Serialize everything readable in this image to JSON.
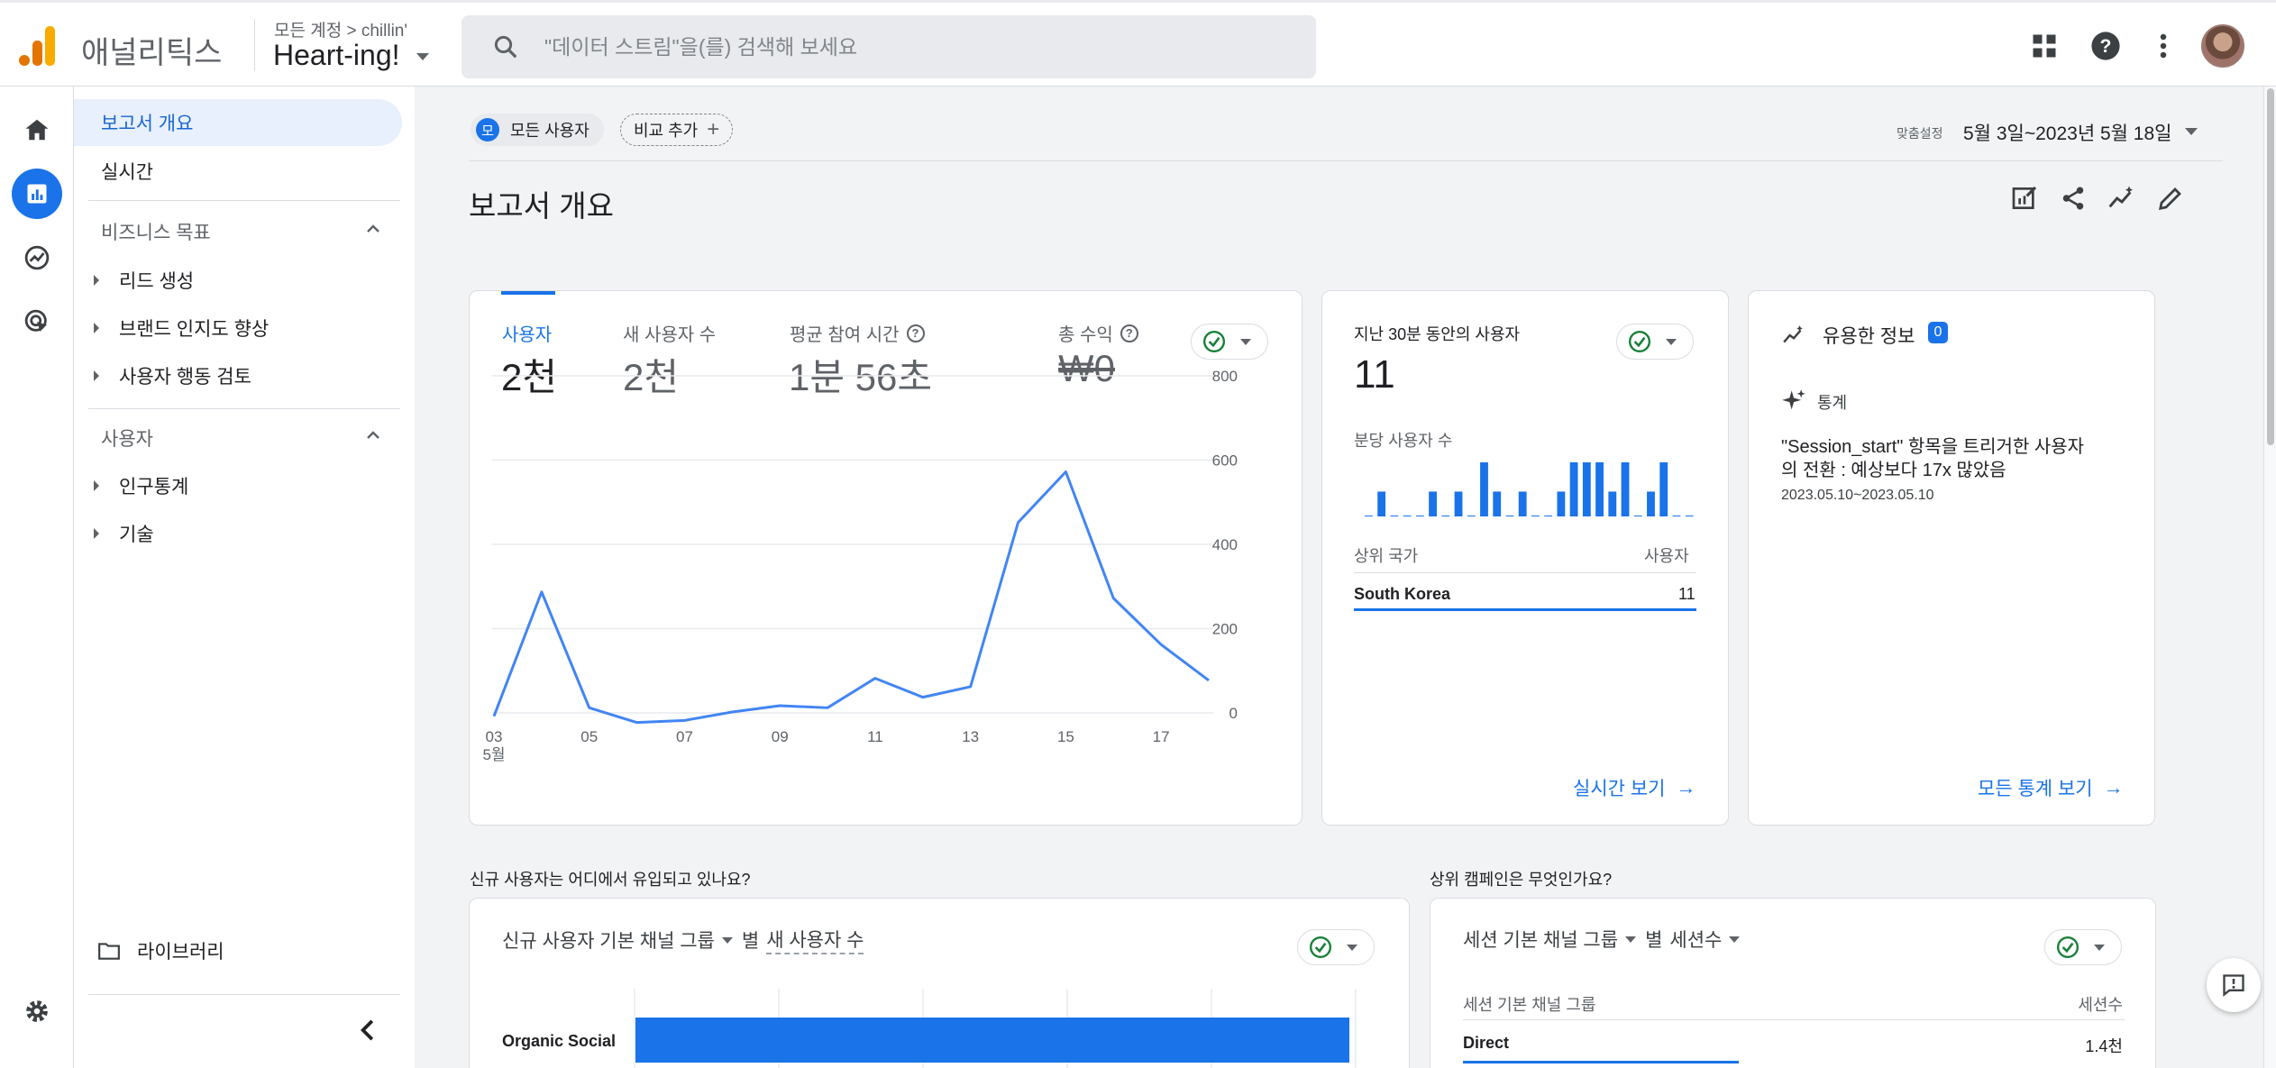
{
  "header": {
    "app_name": "애널리틱스",
    "account_path": "모든 계정 > chillin'",
    "property_name": "Heart-ing!",
    "search_placeholder": "\"데이터 스트림\"을(를) 검색해 보세요"
  },
  "nav": {
    "report_overview": "보고서 개요",
    "realtime": "실시간",
    "business_goals": "비즈니스 목표",
    "lead_gen": "리드 생성",
    "brand_awareness": "브랜드 인지도 향상",
    "user_behavior": "사용자 행동 검토",
    "users_section": "사용자",
    "demographics": "인구통계",
    "tech": "기술",
    "library": "라이브러리"
  },
  "main": {
    "chip_all_badge": "모",
    "chip_all": "모든 사용자",
    "chip_compare": "비교 추가",
    "date_label": "맞춤설정",
    "date_range": "5월 3일~2023년 5월 18일",
    "title": "보고서 개요"
  },
  "metrics_card": {
    "metrics": [
      {
        "label": "사용자",
        "value": "2천"
      },
      {
        "label": "새 사용자 수",
        "value": "2천"
      },
      {
        "label": "평균 참여 시간",
        "value": "1분 56초"
      },
      {
        "label": "총 수익",
        "value": "₩0"
      }
    ]
  },
  "realtime_card": {
    "title": "지난 30분 동안의 사용자",
    "value": "11",
    "per_minute_label": "분당 사용자 수",
    "col_country": "상위 국가",
    "col_users": "사용자",
    "country": "South Korea",
    "country_value": "11",
    "link": "실시간 보기"
  },
  "insights_card": {
    "title": "유용한 정보",
    "badge": "0",
    "section": "통계",
    "text_line1": "\"Session_start\" 항목을 트리거한 사용자",
    "text_line2": "의 전환 : 예상보다 17x 많았음",
    "date": "2023.05.10~2023.05.10",
    "link": "모든 통계 보기"
  },
  "bottom_left": {
    "question": "신규 사용자는 어디에서 유입되고 있나요?",
    "dim": "신규 사용자 기본 채널 그룹",
    "by": "별",
    "metric": "새 사용자 수",
    "row_label": "Organic Social"
  },
  "bottom_right": {
    "question": "상위 캠페인은 무엇인가요?",
    "dim": "세션 기본 채널 그룹",
    "by": "별",
    "metric": "세션수",
    "col_dim": "세션 기본 채널 그룹",
    "col_metric": "세션수",
    "row_label": "Direct",
    "row_value": "1.4천"
  },
  "chart_data": [
    {
      "type": "line",
      "title": "",
      "series": [
        {
          "name": "사용자",
          "values": [
            5,
            300,
            25,
            -10,
            -5,
            15,
            30,
            25,
            95,
            50,
            75,
            465,
            585,
            285,
            175,
            90
          ]
        }
      ],
      "x": [
        "03",
        "04",
        "05",
        "06",
        "07",
        "08",
        "09",
        "10",
        "11",
        "12",
        "13",
        "14",
        "15",
        "16",
        "17",
        "18"
      ],
      "x_tick_labels": [
        "03",
        "05",
        "07",
        "09",
        "11",
        "13",
        "15",
        "17"
      ],
      "x_sublabel": "5월",
      "y_ticks": [
        "800",
        "600",
        "400",
        "200",
        "0"
      ],
      "ylim": [
        0,
        800
      ],
      "color": "#4285f4"
    },
    {
      "type": "bar",
      "title": "분당 사용자 수",
      "values": [
        0,
        4,
        0,
        0,
        0,
        4,
        0,
        4,
        0,
        9,
        4,
        0,
        4,
        0,
        0,
        4,
        9,
        9,
        9,
        4,
        9,
        0,
        4,
        9,
        0,
        0
      ],
      "color": "#1a73e8"
    },
    {
      "type": "bar",
      "title": "신규 사용자 기본 채널 그룹 별 새 사용자 수",
      "categories": [
        "Organic Social"
      ],
      "values": [
        2000
      ],
      "color": "#1a73e8"
    }
  ],
  "colors": {
    "accent": "#1a73e8",
    "brand_orange": "#f9ab00",
    "brand_dark": "#e37400"
  }
}
